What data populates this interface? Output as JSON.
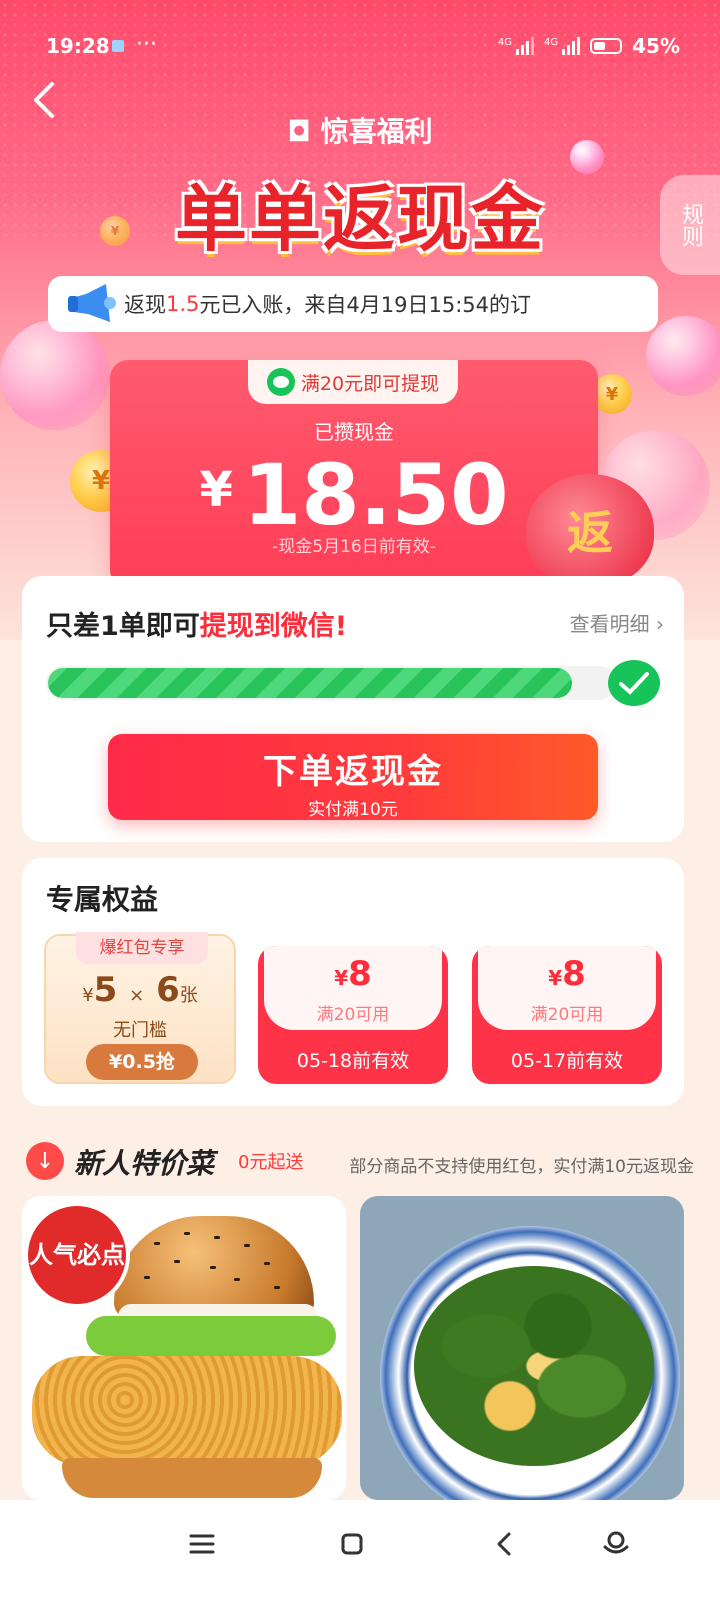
{
  "status_bar": {
    "time": "19:28",
    "dots": "···",
    "net1": "4G",
    "net2": "4G",
    "battery": "45%"
  },
  "hero": {
    "brand": "惊喜福利",
    "headline": "单单返现金",
    "rules": "规则"
  },
  "ticker": {
    "prefix": "返现",
    "amount": "1.5",
    "suffix": "元已入账，来自4月19日15:54的订"
  },
  "cash": {
    "tag": "满20元即可提现",
    "label": "已攒现金",
    "currency": "¥",
    "amount": "18.50",
    "expire": "-现金5月16日前有效-",
    "bag_text": "返"
  },
  "withdraw": {
    "title_prefix": "只差1单即可",
    "title_highlight": "提现到微信!",
    "detail": "查看明细",
    "progress": 0.92,
    "button_main": "下单返现金",
    "button_sub": "实付满10元"
  },
  "benefits": {
    "title": "专属权益",
    "gold": {
      "tag": "爆红包专享",
      "currency": "¥",
      "value": "5",
      "times": "×",
      "count": "6",
      "unit": "张",
      "sub": "无门槛",
      "grab": "¥0.5抢"
    },
    "coupons": [
      {
        "currency": "¥",
        "value": "8",
        "cond": "满20可用",
        "expire": "05-18前有效"
      },
      {
        "currency": "¥",
        "value": "8",
        "cond": "满20可用",
        "expire": "05-17前有效"
      }
    ]
  },
  "newuser": {
    "title": "新人特价菜",
    "zero": "0元起送",
    "note": "部分商品不支持使用红包，实付满10元返现金",
    "badge": "人气必点"
  },
  "colors": {
    "accent": "#ff2d3b",
    "wechat": "#17c45a",
    "gold": "#8a4a1a"
  }
}
